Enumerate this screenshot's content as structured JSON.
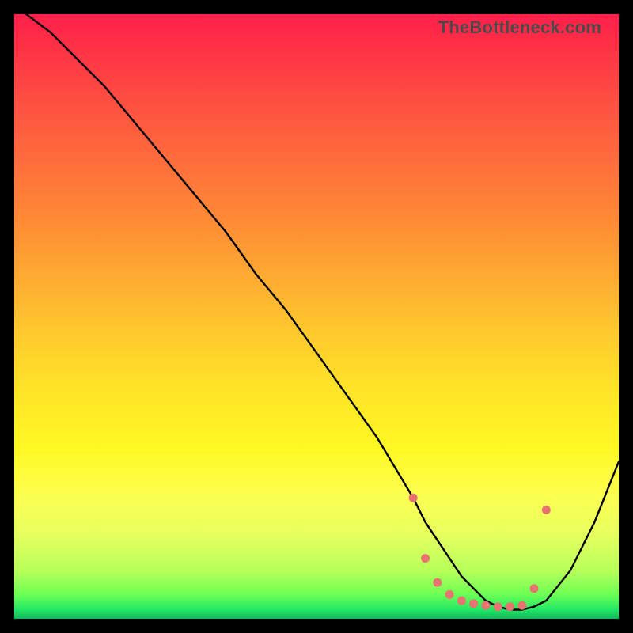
{
  "watermark": "TheBottleneck.com",
  "chart_data": {
    "type": "line",
    "title": "",
    "xlabel": "",
    "ylabel": "",
    "xlim": [
      0,
      100
    ],
    "ylim": [
      0,
      100
    ],
    "series": [
      {
        "name": "bottleneck-curve",
        "x": [
          2,
          6,
          10,
          15,
          20,
          25,
          30,
          35,
          40,
          45,
          50,
          55,
          60,
          63,
          66,
          68,
          70,
          72,
          74,
          76,
          78,
          80,
          82,
          84,
          86,
          88,
          92,
          96,
          100
        ],
        "y": [
          100,
          97,
          93,
          88,
          82,
          76,
          70,
          64,
          57,
          51,
          44,
          37,
          30,
          25,
          20,
          16,
          13,
          10,
          7,
          5,
          3,
          2,
          1.5,
          1.5,
          2,
          3,
          8,
          16,
          26
        ]
      }
    ],
    "highlight_points": {
      "name": "optimal-range-dots",
      "color": "#e77471",
      "x": [
        66,
        68,
        70,
        72,
        74,
        76,
        78,
        80,
        82,
        84,
        86,
        88
      ],
      "y": [
        20,
        10,
        6,
        4,
        3,
        2.5,
        2.2,
        2,
        2,
        2.2,
        5,
        18
      ]
    }
  }
}
